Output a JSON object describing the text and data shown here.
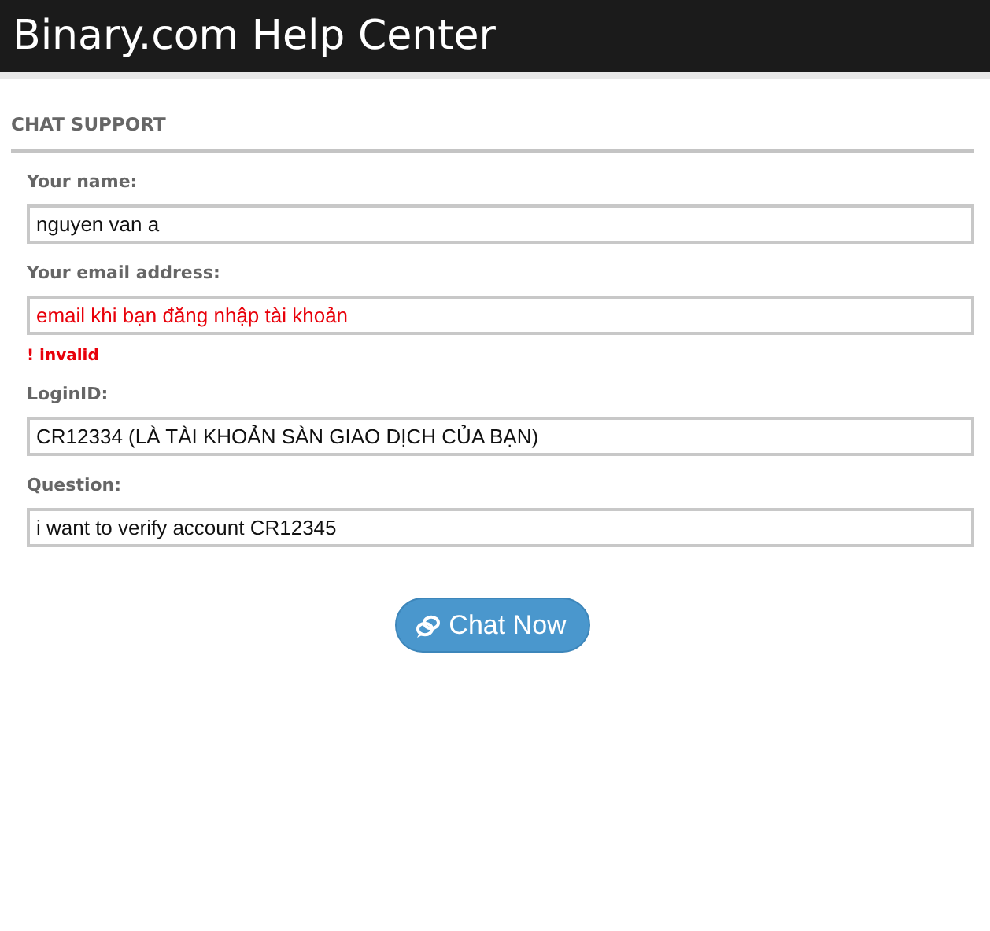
{
  "header": {
    "title": "Binary.com Help Center"
  },
  "section": {
    "title": "CHAT SUPPORT"
  },
  "fields": [
    {
      "label": "Your name:",
      "value": "nguyen van a",
      "invalid": false
    },
    {
      "label": "Your email address:",
      "value": "email khi bạn đăng nhập tài khoản",
      "invalid": true,
      "error": "! invalid"
    },
    {
      "label": "LoginID:",
      "value": "CR12334 (LÀ TÀI KHOẢN SÀN GIAO DỊCH CỦA BẠN)",
      "invalid": false
    },
    {
      "label": "Question:",
      "value": "i want to verify account CR12345",
      "invalid": false
    }
  ],
  "button": {
    "label": "Chat Now"
  }
}
